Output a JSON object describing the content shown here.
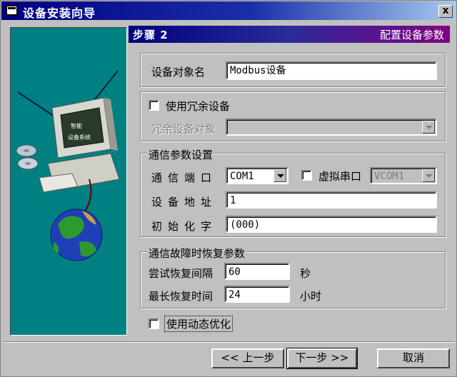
{
  "window": {
    "title": "设备安装向导",
    "close_label": "x"
  },
  "step": {
    "label": "步骤 2",
    "title": "配置设备参数"
  },
  "device": {
    "name_label": "设备对象名",
    "name_value": "Modbus设备"
  },
  "redundancy": {
    "checkbox_label": "使用冗余设备",
    "object_label": "冗余设备对象",
    "object_value": ""
  },
  "comm": {
    "group_title": "通信参数设置",
    "port_label": "通信端口",
    "port_value": "COM1",
    "virtual_serial_label": "虚拟串口",
    "virtual_serial_value": "VCOM1",
    "address_label": "设备地址",
    "address_value": "1",
    "init_label": "初始化字",
    "init_value": "(000)"
  },
  "recovery": {
    "group_title": "通信故障时恢复参数",
    "retry_label": "尝试恢复间隔",
    "retry_value": "60",
    "retry_unit": "秒",
    "max_label": "最长恢复时间",
    "max_value": "24",
    "max_unit": "小时"
  },
  "dynamic": {
    "checkbox_label": "使用动态优化"
  },
  "buttons": {
    "back": "<< 上一步",
    "next": "下一步 >>",
    "cancel": "取消"
  },
  "illustration": {
    "monitor_text_1": "智能",
    "monitor_text_2": "设备系统"
  }
}
